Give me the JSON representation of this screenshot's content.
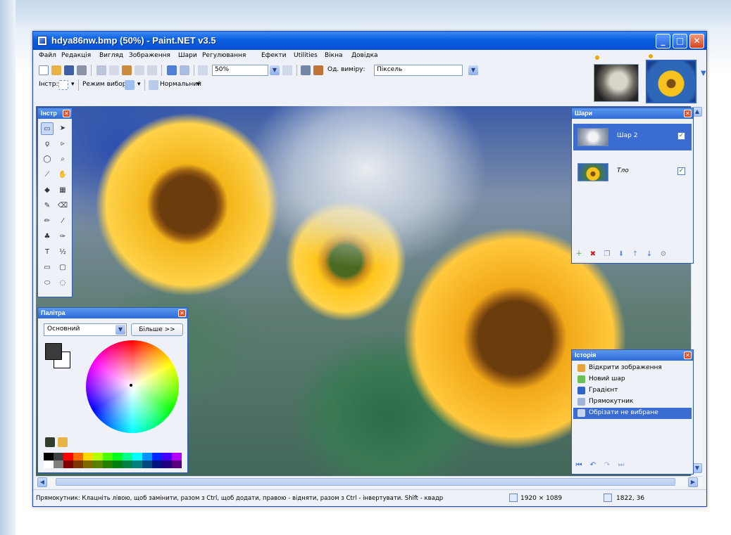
{
  "window": {
    "title": "hdya86nw.bmp (50%) - Paint.NET v3.5",
    "minimize": "_",
    "maximize": "□",
    "close": "✕"
  },
  "menu": [
    "Файл",
    "Редакція",
    "Вигляд",
    "Зображення",
    "Шари",
    "Регулювання",
    "Ефекти",
    "Utilities",
    "Вікна",
    "Довідка"
  ],
  "toolbar": {
    "zoom_value": "50%",
    "units_label": "Од. виміру:",
    "units_value": "Піксель",
    "tool_label": "Інстр:",
    "selection_mode_label": "Режим вибору",
    "blend_mode": "Нормальний"
  },
  "panels": {
    "tools_title": "Інстр",
    "palette_title": "Палітра",
    "palette_mode": "Основний",
    "palette_more": "Більше >>",
    "layers_title": "Шари",
    "history_title": "Історія"
  },
  "layers": [
    {
      "name": "Шар 2",
      "visible": true,
      "selected": true
    },
    {
      "name": "Тло",
      "visible": true,
      "selected": false
    }
  ],
  "history": [
    {
      "label": "Відкрити зображення",
      "icon": "open-image-icon",
      "color": "#e6a23c",
      "selected": false
    },
    {
      "label": "Новий шар",
      "icon": "new-layer-icon",
      "color": "#6bbf55",
      "selected": false
    },
    {
      "label": "Градієнт",
      "icon": "gradient-icon",
      "color": "#2f64c8",
      "selected": false
    },
    {
      "label": "Прямокутник",
      "icon": "rectangle-select-icon",
      "color": "#9fb4d8",
      "selected": false
    },
    {
      "label": "Обрізати не вибране",
      "icon": "crop-icon",
      "color": "#c9d6ee",
      "selected": true
    }
  ],
  "status": {
    "hint": "Прямокутник: Клацніть лівою, щоб замінити, разом з Ctrl, щоб додати, правою - відняти, разом з Ctrl - інвертувати. Shift - квадр",
    "image_size": "1920 × 1089",
    "cursor_pos": "1822, 36"
  },
  "palette_colors": [
    "#000000",
    "#404040",
    "#ff0000",
    "#ff6a00",
    "#ffd800",
    "#b6ff00",
    "#4cff00",
    "#00ff21",
    "#00ff90",
    "#00ffff",
    "#0094ff",
    "#0026ff",
    "#4800ff",
    "#b200ff",
    "#ffffff",
    "#808080",
    "#7f0000",
    "#7f3300",
    "#7f6a00",
    "#5b7f00",
    "#267f00",
    "#007f0e",
    "#007f46",
    "#007f7f",
    "#004a7f",
    "#00137f",
    "#21007f",
    "#57007f"
  ]
}
